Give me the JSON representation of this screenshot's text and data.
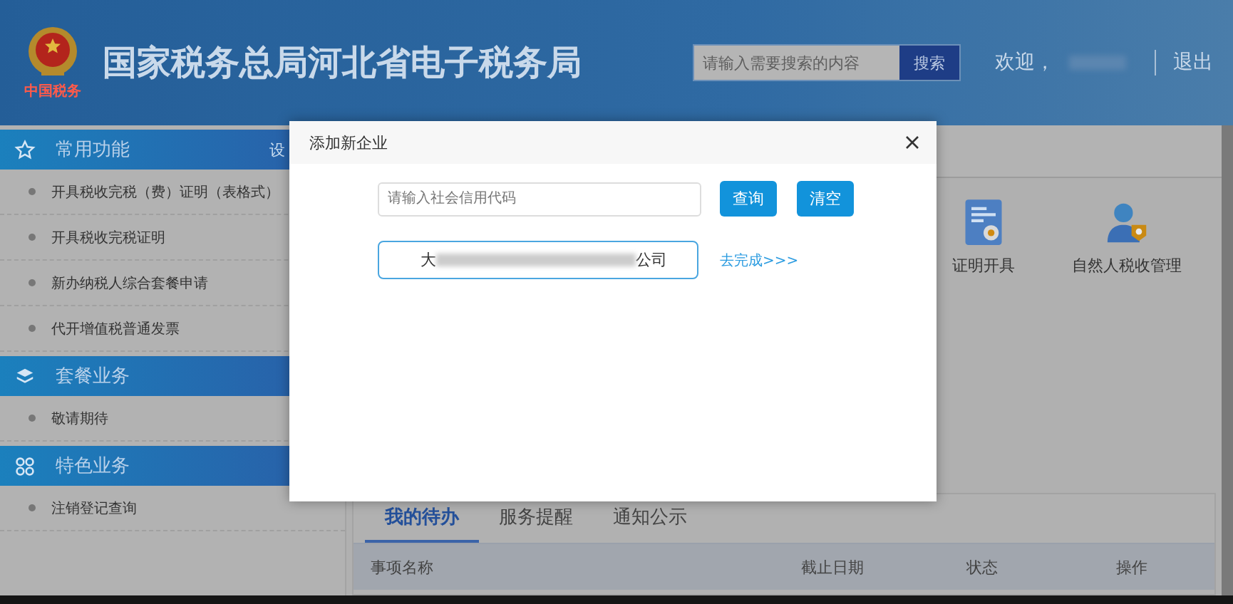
{
  "header": {
    "title": "国家税务总局河北省电子税务局",
    "emblem_caption": "中国税务",
    "search": {
      "placeholder": "请输入需要搜索的内容",
      "button": "搜索"
    },
    "welcome": "欢迎，",
    "logout": "退出"
  },
  "sidebar": {
    "sections": [
      {
        "title": "常用功能",
        "action": "设",
        "items": [
          {
            "label": "开具税收完税（费）证明（表格式）"
          },
          {
            "label": "开具税收完税证明"
          },
          {
            "label": "新办纳税人综合套餐申请"
          },
          {
            "label": "代开增值税普通发票"
          }
        ]
      },
      {
        "title": "套餐业务",
        "items": [
          {
            "label": "敬请期待"
          }
        ]
      },
      {
        "title": "特色业务",
        "items": [
          {
            "label": "注销登记查询"
          }
        ]
      }
    ]
  },
  "shortcuts": [
    {
      "label": "证明开具"
    },
    {
      "label": "自然人税收管理"
    }
  ],
  "tabs": [
    {
      "label": "我的待办",
      "selected": true
    },
    {
      "label": "服务提醒",
      "selected": false
    },
    {
      "label": "通知公示",
      "selected": false
    }
  ],
  "table": {
    "columns": [
      "事项名称",
      "截止日期",
      "状态",
      "操作"
    ]
  },
  "dialog": {
    "title": "添加新企业",
    "search": {
      "placeholder": "请输入社会信用代码"
    },
    "buttons": [
      "查询",
      "清空"
    ],
    "result": {
      "prefix": "大",
      "suffix": "公司"
    },
    "link": "去完成>>>"
  }
}
